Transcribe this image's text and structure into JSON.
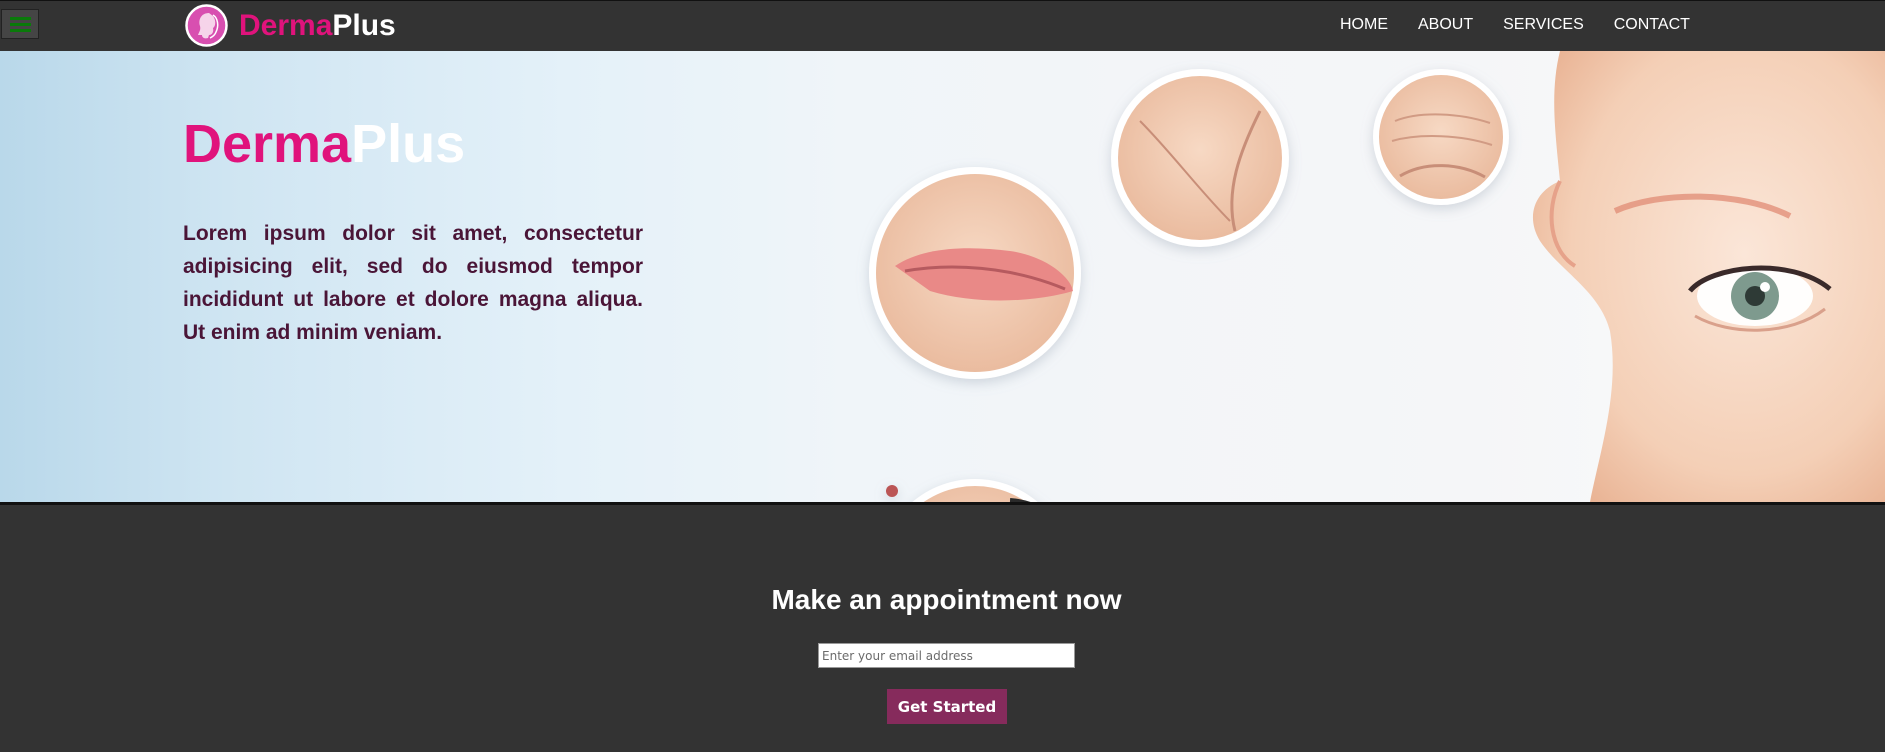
{
  "navbar": {
    "brand_part1": "Derma",
    "brand_part2": "Plus",
    "links": [
      "HOME",
      "ABOUT",
      "SERVICES",
      "CONTACT"
    ]
  },
  "hero": {
    "title_part1": "Derma",
    "title_part2": "Plus",
    "description": "Lorem ipsum dolor sit amet, consectetur adipisicing elit, sed do eiusmod tempor incididunt ut labore et dolore magna aliqua. Ut enim ad minim veniam."
  },
  "appointment": {
    "title": "Make an appointment now",
    "email_placeholder": "Enter your email address",
    "button_label": "Get Started"
  },
  "colors": {
    "brand_pink": "#e0137c",
    "button_plum": "#862b5c",
    "hero_text": "#4a1537",
    "dark_bg": "#333333",
    "menu_icon": "#0a7a0a"
  },
  "icons": [
    "menu-icon",
    "woman-profile-logo-icon"
  ]
}
